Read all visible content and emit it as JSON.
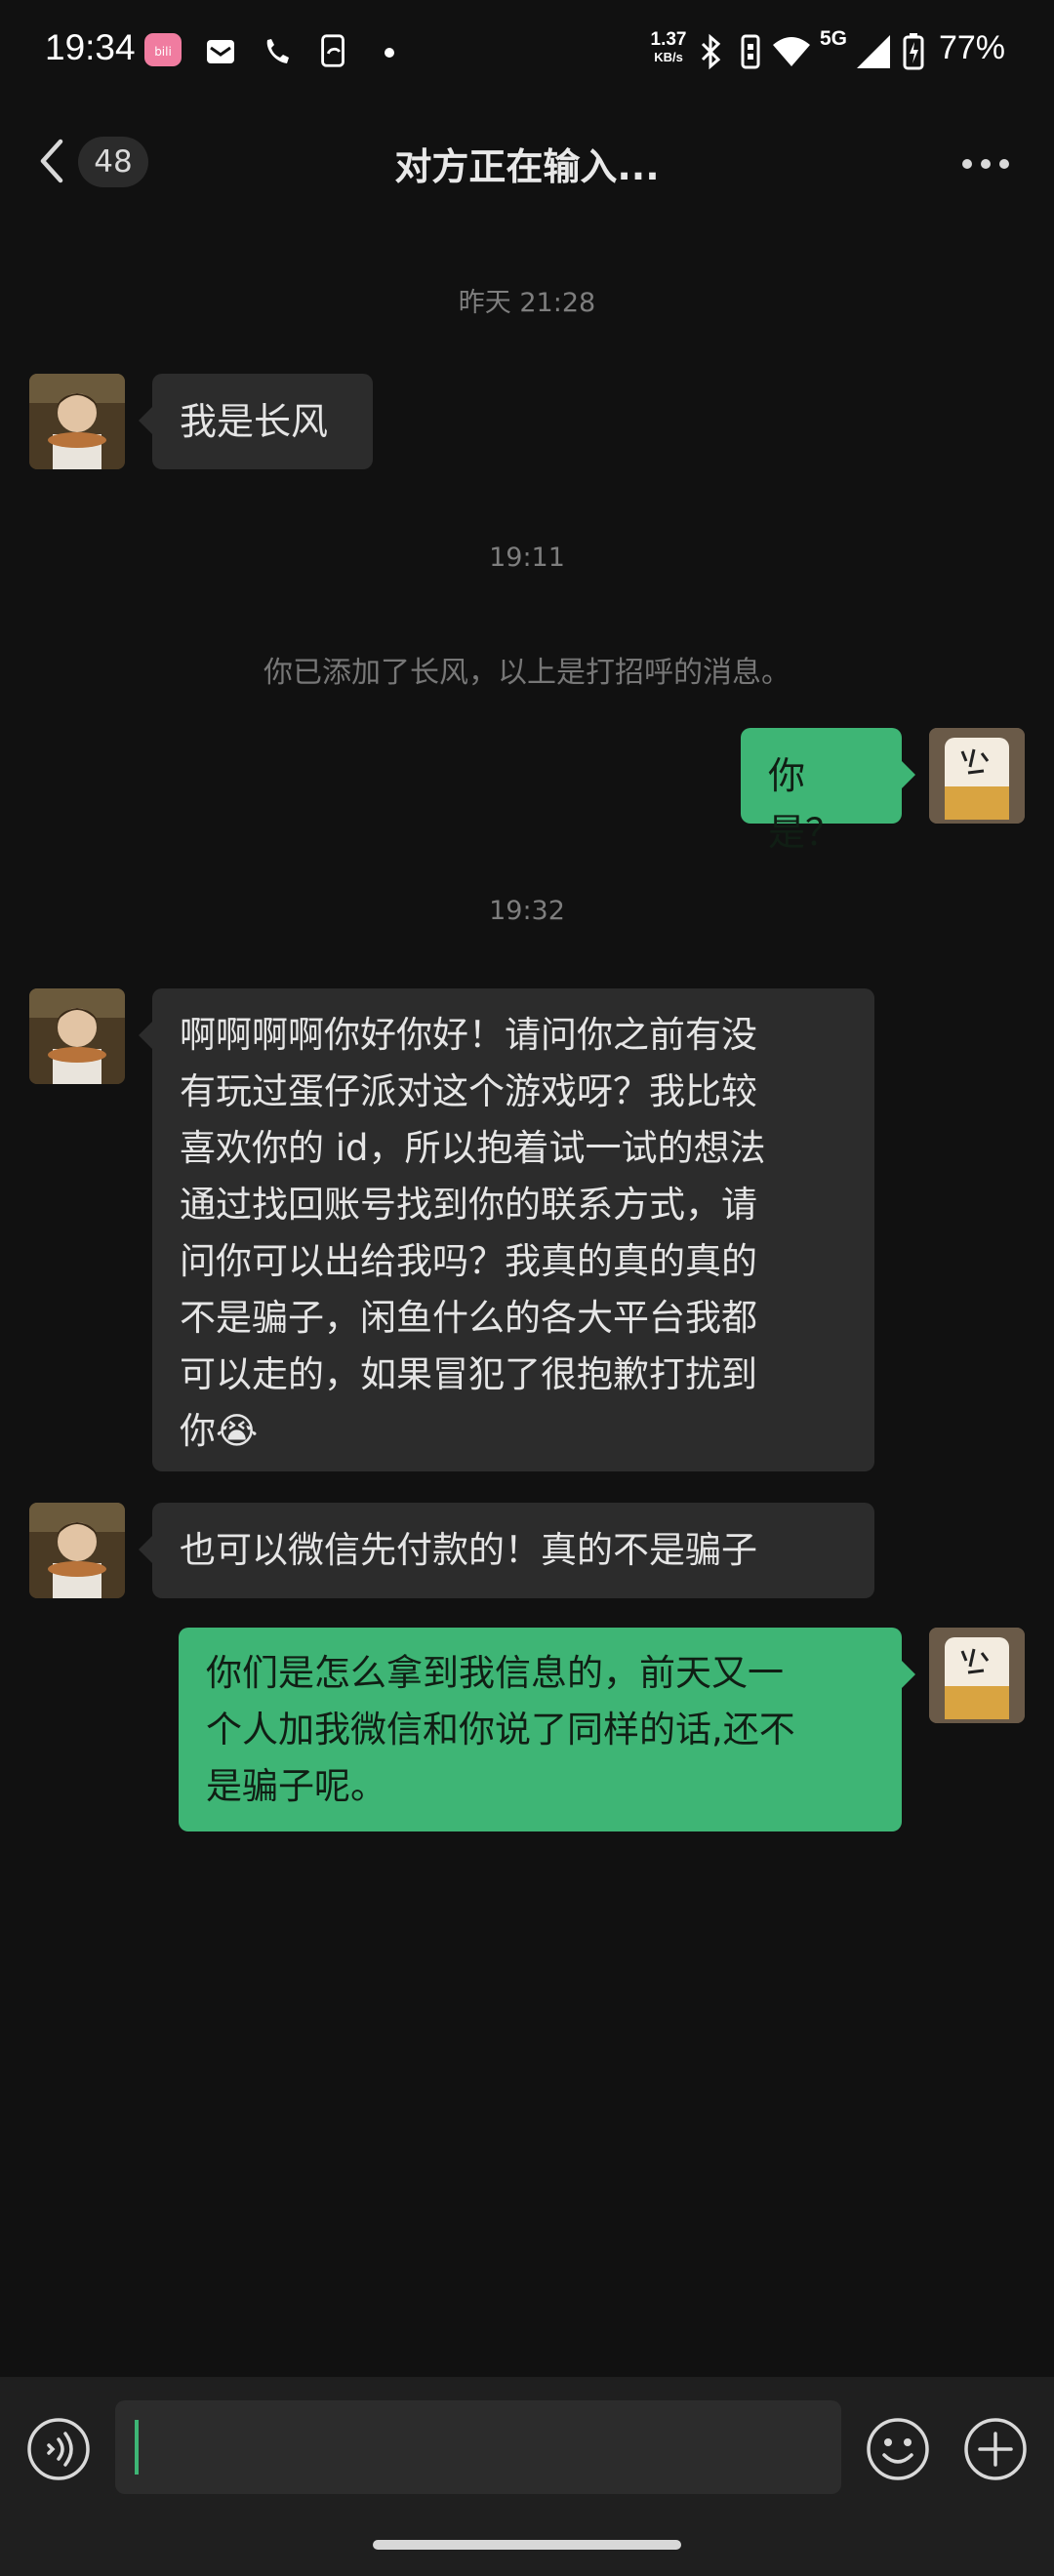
{
  "status_bar": {
    "time": "19:34",
    "net_speed": "1.37",
    "net_unit": "KB/s",
    "network": "5G",
    "battery": "77%"
  },
  "nav": {
    "unread_count": "48",
    "title": "对方正在输入..."
  },
  "timestamps": {
    "t1": "昨天 21:28",
    "t2": "19:11",
    "t3": "19:32"
  },
  "system_message": "你已添加了长风，以上是打招呼的消息。",
  "messages": [
    {
      "side": "in",
      "text": "我是长风"
    },
    {
      "side": "out",
      "text": "你是？"
    },
    {
      "side": "in",
      "text": "啊啊啊啊你好你好！请问你之前有没\n有玩过蛋仔派对这个游戏呀？我比较\n喜欢你的 id，所以抱着试一试的想法\n通过找回账号找到你的联系方式，请\n问你可以出给我吗？我真的真的真的\n不是骗子，闲鱼什么的各大平台我都\n可以走的，如果冒犯了很抱歉打扰到\n你😭"
    },
    {
      "side": "in",
      "text": "也可以微信先付款的！真的不是骗子"
    },
    {
      "side": "out",
      "text": "你们是怎么拿到我信息的，前天又一\n个人加我微信和你说了同样的话,还不\n是骗子呢。"
    }
  ],
  "colors": {
    "background": "#111111",
    "bubble_in": "#2c2c2c",
    "bubble_out": "#3eb575",
    "input_bar": "#1f1f1f"
  }
}
